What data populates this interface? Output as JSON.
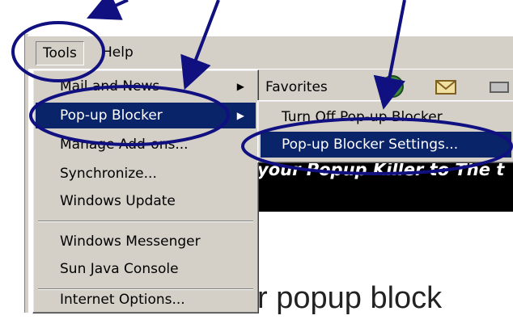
{
  "menubar": {
    "tools_label": "Tools",
    "help_label": "Help"
  },
  "toolbar": {
    "favorites_label": "Favorites"
  },
  "tools_menu": {
    "items": [
      {
        "label": "Mail and News",
        "has_submenu": true
      },
      {
        "label": "Pop-up Blocker",
        "has_submenu": true,
        "selected": true
      },
      {
        "label": "Manage Add-ons..."
      },
      {
        "label": "Synchronize..."
      },
      {
        "label": "Windows Update"
      },
      {
        "label": "Windows Messenger"
      },
      {
        "label": "Sun Java Console"
      },
      {
        "label": "Internet Options..."
      }
    ]
  },
  "popup_submenu": {
    "items": [
      {
        "label": "Turn Off Pop-up Blocker"
      },
      {
        "label": "Pop-up Blocker Settings...",
        "selected": true
      }
    ]
  },
  "page": {
    "banner_text": "your Popup Killer to The t",
    "heading_text": "r popup block"
  },
  "colors": {
    "highlight": "#0a246a",
    "annotation": "#101080",
    "menu_bg": "#d4d0c8"
  }
}
